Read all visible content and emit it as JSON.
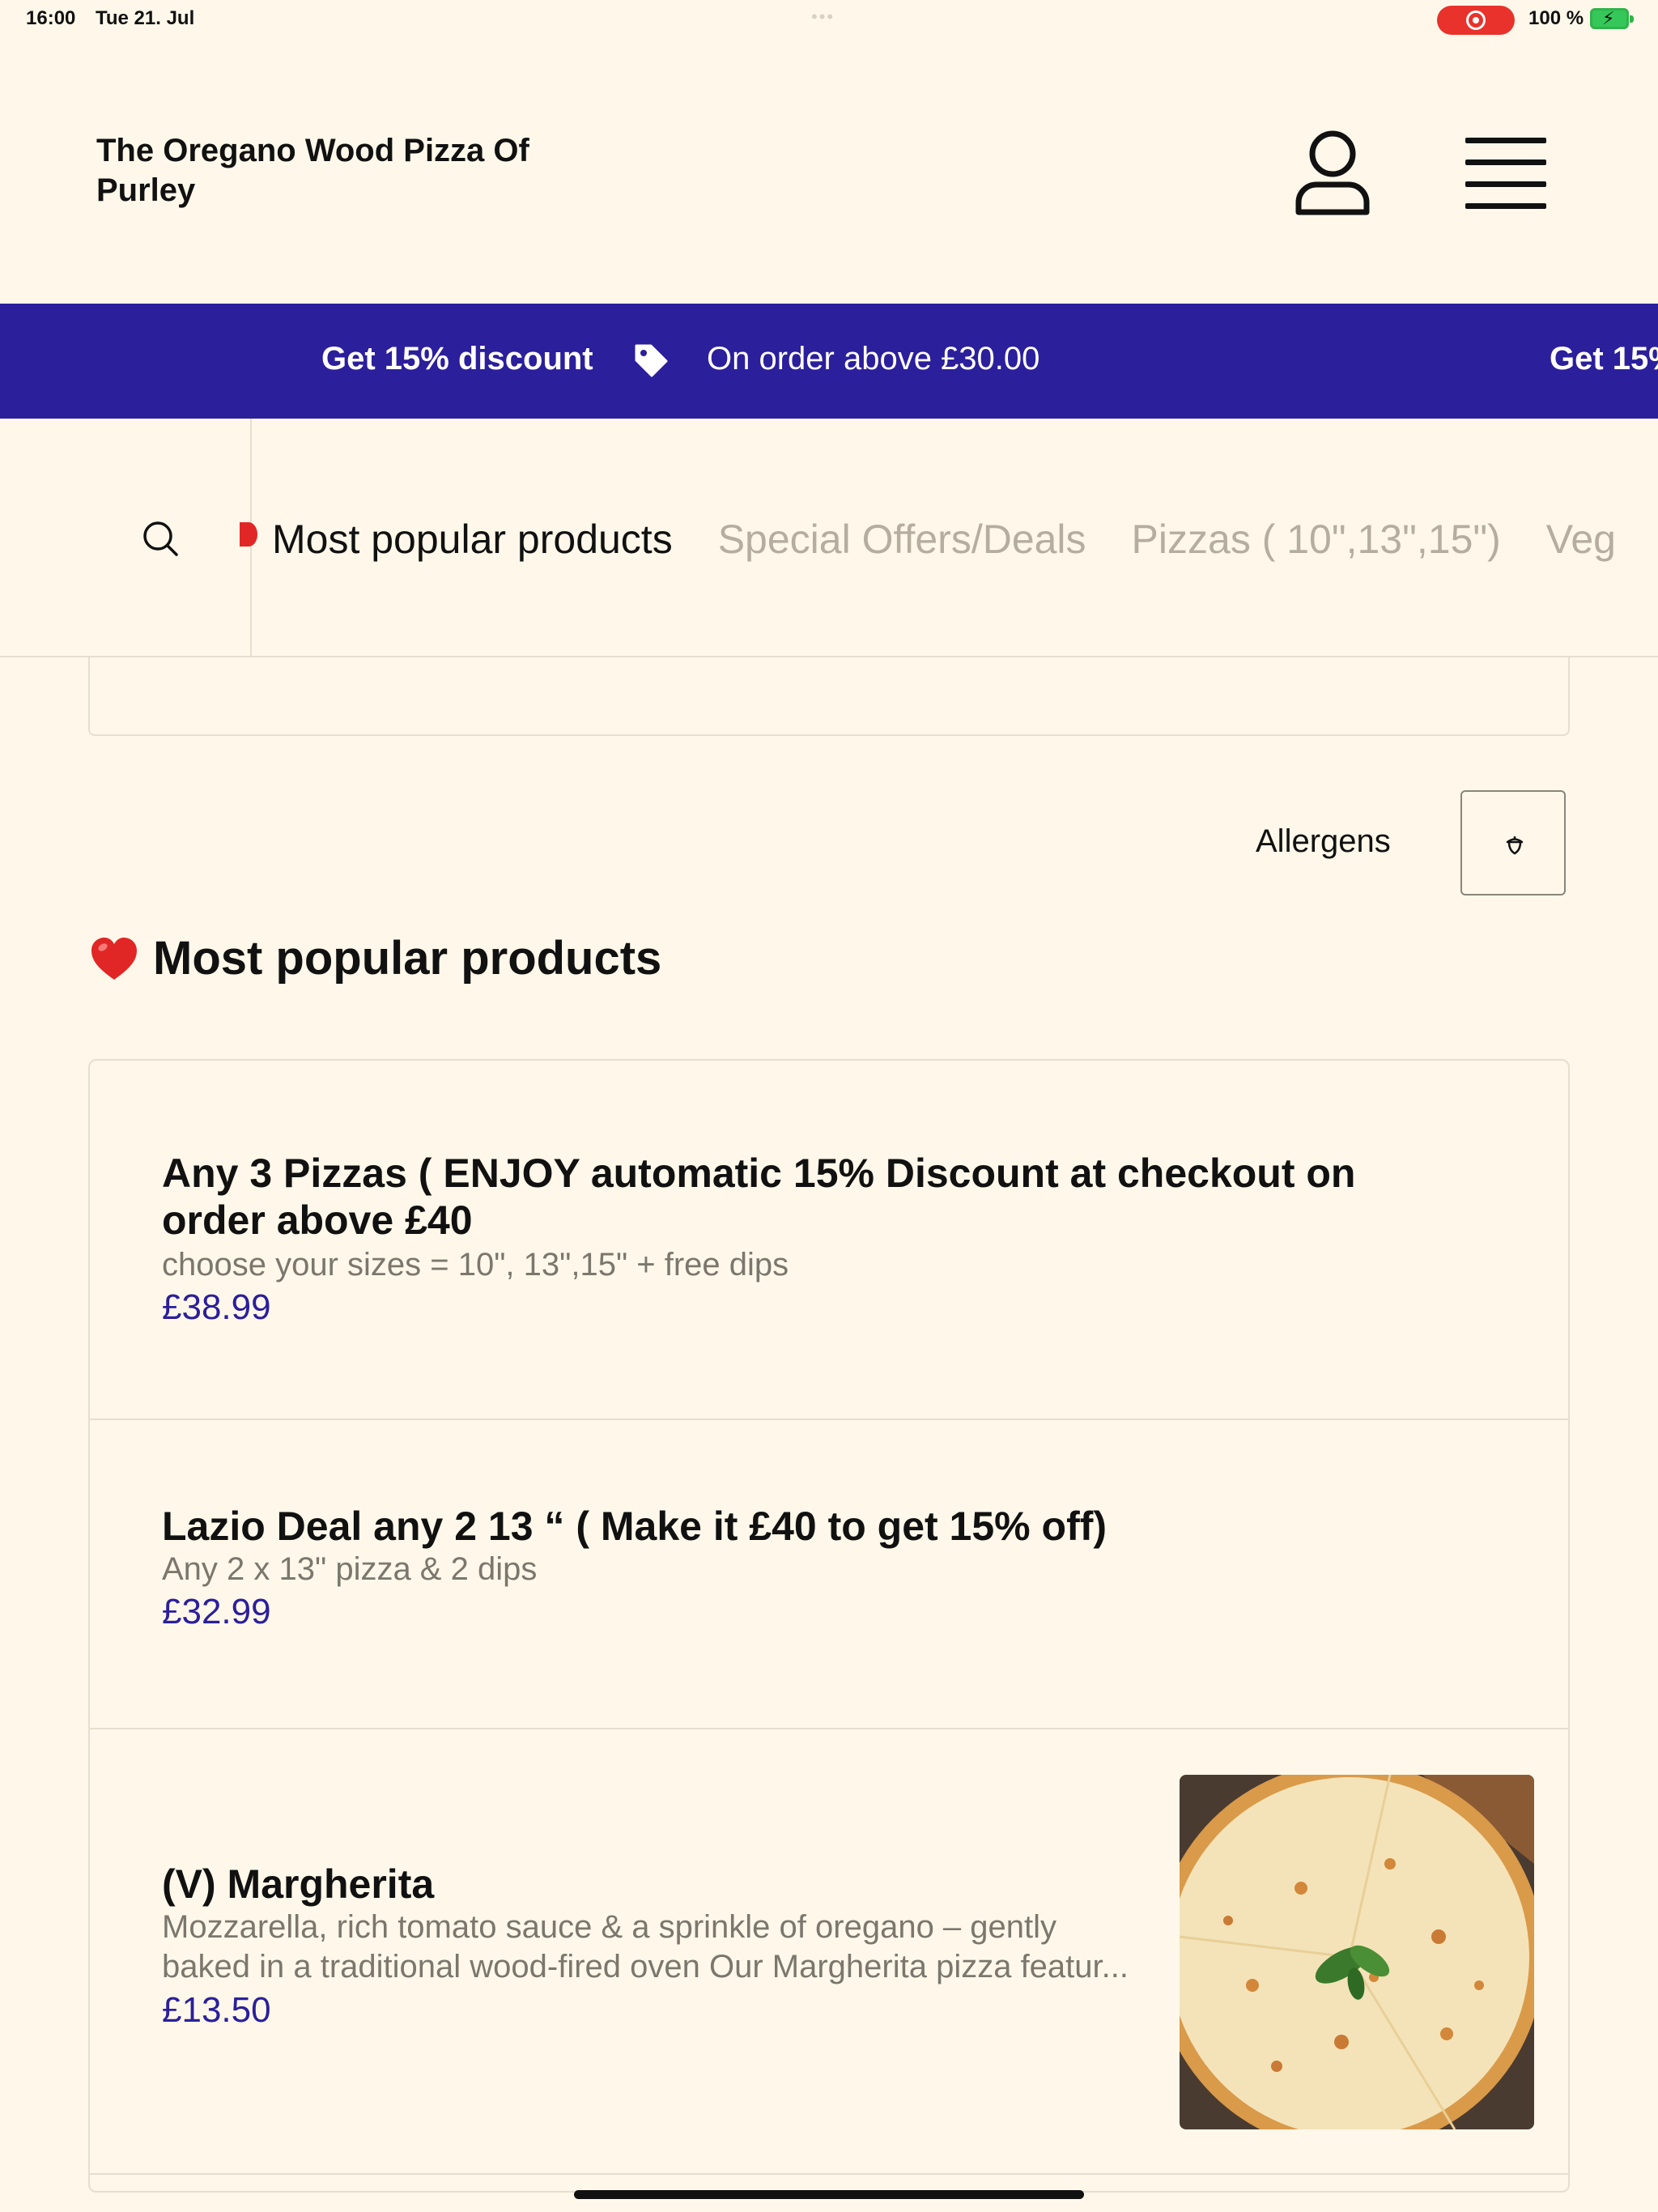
{
  "status_bar": {
    "time": "16:00",
    "date": "Tue 21. Jul",
    "battery": "100 %"
  },
  "header": {
    "restaurant_name": "The Oregano Wood Pizza Of Purley",
    "account_icon": "user-icon",
    "menu_icon": "hamburger-menu-icon"
  },
  "promo": {
    "title": "Get 15% discount",
    "subtitle": "On order above £30.00",
    "title_repeat": "Get 15%",
    "background": "#2b1f9b"
  },
  "categories": {
    "tabs": [
      "Most popular products",
      "Special Offers/Deals",
      "Pizzas ( 10\",13\",15\")",
      "Veg"
    ],
    "active_index": 0
  },
  "allergens": {
    "label": "Allergens"
  },
  "section": {
    "title": "Most popular products"
  },
  "products": [
    {
      "name": "Any 3 Pizzas (  ENJOY automatic 15% Discount at checkout on order above £40",
      "description": "choose your sizes = 10\", 13\",15\" + free dips",
      "price": "£38.99"
    },
    {
      "name": "Lazio Deal any 2 13 “ ( Make it £40 to get 15% off)",
      "description": "Any 2 x 13\" pizza & 2 dips",
      "price": "£32.99"
    },
    {
      "name": "(V) Margherita",
      "description": "Mozzarella, rich tomato sauce & a sprinkle of oregano – gently baked in a traditional wood-fired oven Our Margherita pizza featur...",
      "price": "£13.50"
    }
  ],
  "colors": {
    "background": "#fff8ea",
    "accent": "#2b1f9b",
    "muted_text": "#7c776d",
    "inactive_tab": "#b5aea0"
  }
}
